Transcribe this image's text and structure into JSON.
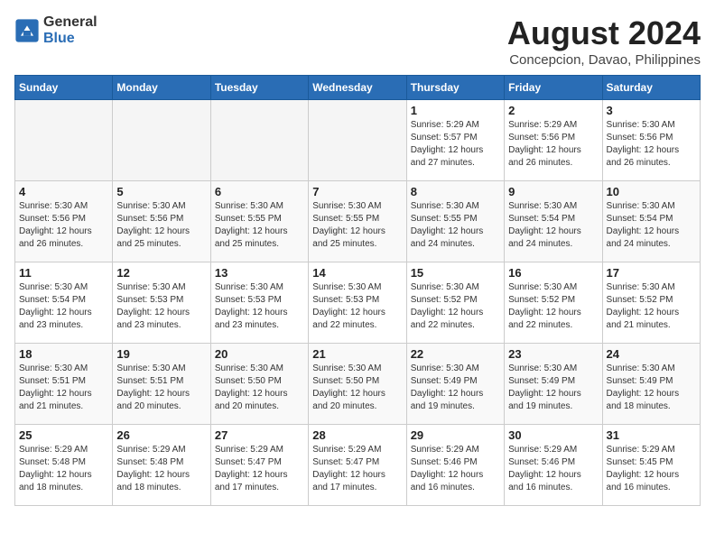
{
  "header": {
    "logo": {
      "general": "General",
      "blue": "Blue"
    },
    "title": "August 2024",
    "location": "Concepcion, Davao, Philippines"
  },
  "weekdays": [
    "Sunday",
    "Monday",
    "Tuesday",
    "Wednesday",
    "Thursday",
    "Friday",
    "Saturday"
  ],
  "weeks": [
    [
      {
        "day": "",
        "info": ""
      },
      {
        "day": "",
        "info": ""
      },
      {
        "day": "",
        "info": ""
      },
      {
        "day": "",
        "info": ""
      },
      {
        "day": "1",
        "info": "Sunrise: 5:29 AM\nSunset: 5:57 PM\nDaylight: 12 hours\nand 27 minutes."
      },
      {
        "day": "2",
        "info": "Sunrise: 5:29 AM\nSunset: 5:56 PM\nDaylight: 12 hours\nand 26 minutes."
      },
      {
        "day": "3",
        "info": "Sunrise: 5:30 AM\nSunset: 5:56 PM\nDaylight: 12 hours\nand 26 minutes."
      }
    ],
    [
      {
        "day": "4",
        "info": "Sunrise: 5:30 AM\nSunset: 5:56 PM\nDaylight: 12 hours\nand 26 minutes."
      },
      {
        "day": "5",
        "info": "Sunrise: 5:30 AM\nSunset: 5:56 PM\nDaylight: 12 hours\nand 25 minutes."
      },
      {
        "day": "6",
        "info": "Sunrise: 5:30 AM\nSunset: 5:55 PM\nDaylight: 12 hours\nand 25 minutes."
      },
      {
        "day": "7",
        "info": "Sunrise: 5:30 AM\nSunset: 5:55 PM\nDaylight: 12 hours\nand 25 minutes."
      },
      {
        "day": "8",
        "info": "Sunrise: 5:30 AM\nSunset: 5:55 PM\nDaylight: 12 hours\nand 24 minutes."
      },
      {
        "day": "9",
        "info": "Sunrise: 5:30 AM\nSunset: 5:54 PM\nDaylight: 12 hours\nand 24 minutes."
      },
      {
        "day": "10",
        "info": "Sunrise: 5:30 AM\nSunset: 5:54 PM\nDaylight: 12 hours\nand 24 minutes."
      }
    ],
    [
      {
        "day": "11",
        "info": "Sunrise: 5:30 AM\nSunset: 5:54 PM\nDaylight: 12 hours\nand 23 minutes."
      },
      {
        "day": "12",
        "info": "Sunrise: 5:30 AM\nSunset: 5:53 PM\nDaylight: 12 hours\nand 23 minutes."
      },
      {
        "day": "13",
        "info": "Sunrise: 5:30 AM\nSunset: 5:53 PM\nDaylight: 12 hours\nand 23 minutes."
      },
      {
        "day": "14",
        "info": "Sunrise: 5:30 AM\nSunset: 5:53 PM\nDaylight: 12 hours\nand 22 minutes."
      },
      {
        "day": "15",
        "info": "Sunrise: 5:30 AM\nSunset: 5:52 PM\nDaylight: 12 hours\nand 22 minutes."
      },
      {
        "day": "16",
        "info": "Sunrise: 5:30 AM\nSunset: 5:52 PM\nDaylight: 12 hours\nand 22 minutes."
      },
      {
        "day": "17",
        "info": "Sunrise: 5:30 AM\nSunset: 5:52 PM\nDaylight: 12 hours\nand 21 minutes."
      }
    ],
    [
      {
        "day": "18",
        "info": "Sunrise: 5:30 AM\nSunset: 5:51 PM\nDaylight: 12 hours\nand 21 minutes."
      },
      {
        "day": "19",
        "info": "Sunrise: 5:30 AM\nSunset: 5:51 PM\nDaylight: 12 hours\nand 20 minutes."
      },
      {
        "day": "20",
        "info": "Sunrise: 5:30 AM\nSunset: 5:50 PM\nDaylight: 12 hours\nand 20 minutes."
      },
      {
        "day": "21",
        "info": "Sunrise: 5:30 AM\nSunset: 5:50 PM\nDaylight: 12 hours\nand 20 minutes."
      },
      {
        "day": "22",
        "info": "Sunrise: 5:30 AM\nSunset: 5:49 PM\nDaylight: 12 hours\nand 19 minutes."
      },
      {
        "day": "23",
        "info": "Sunrise: 5:30 AM\nSunset: 5:49 PM\nDaylight: 12 hours\nand 19 minutes."
      },
      {
        "day": "24",
        "info": "Sunrise: 5:30 AM\nSunset: 5:49 PM\nDaylight: 12 hours\nand 18 minutes."
      }
    ],
    [
      {
        "day": "25",
        "info": "Sunrise: 5:29 AM\nSunset: 5:48 PM\nDaylight: 12 hours\nand 18 minutes."
      },
      {
        "day": "26",
        "info": "Sunrise: 5:29 AM\nSunset: 5:48 PM\nDaylight: 12 hours\nand 18 minutes."
      },
      {
        "day": "27",
        "info": "Sunrise: 5:29 AM\nSunset: 5:47 PM\nDaylight: 12 hours\nand 17 minutes."
      },
      {
        "day": "28",
        "info": "Sunrise: 5:29 AM\nSunset: 5:47 PM\nDaylight: 12 hours\nand 17 minutes."
      },
      {
        "day": "29",
        "info": "Sunrise: 5:29 AM\nSunset: 5:46 PM\nDaylight: 12 hours\nand 16 minutes."
      },
      {
        "day": "30",
        "info": "Sunrise: 5:29 AM\nSunset: 5:46 PM\nDaylight: 12 hours\nand 16 minutes."
      },
      {
        "day": "31",
        "info": "Sunrise: 5:29 AM\nSunset: 5:45 PM\nDaylight: 12 hours\nand 16 minutes."
      }
    ]
  ]
}
